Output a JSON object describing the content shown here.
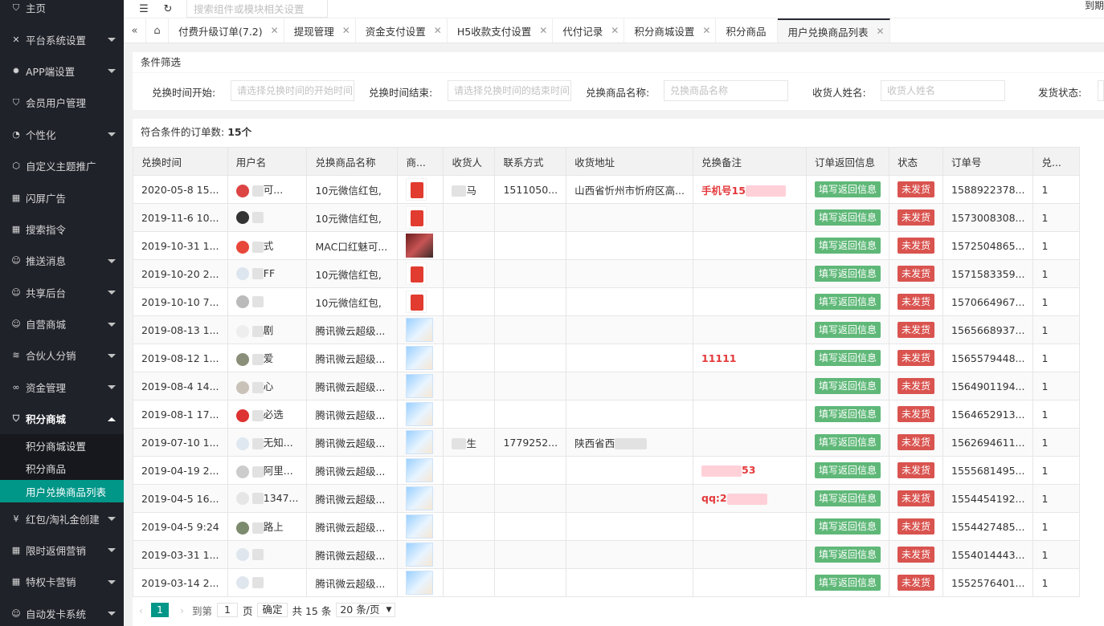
{
  "sidebar": {
    "items": [
      {
        "label": "主页",
        "icon": "shield-icon",
        "arrow": false
      },
      {
        "label": "平台系统设置",
        "icon": "tools-icon",
        "arrow": true
      },
      {
        "label": "APP端设置",
        "icon": "gear-icon",
        "arrow": true
      },
      {
        "label": "会员用户管理",
        "icon": "shield-icon",
        "arrow": false
      },
      {
        "label": "个性化",
        "icon": "palette-icon",
        "arrow": true
      },
      {
        "label": "自定义主题推广",
        "icon": "cube-icon",
        "arrow": false
      },
      {
        "label": "闪屏广告",
        "icon": "grid-icon",
        "arrow": false
      },
      {
        "label": "搜索指令",
        "icon": "grid-icon",
        "arrow": false
      },
      {
        "label": "推送消息",
        "icon": "user-icon",
        "arrow": true
      },
      {
        "label": "共享后台",
        "icon": "user-icon",
        "arrow": true
      },
      {
        "label": "自营商城",
        "icon": "user-icon",
        "arrow": true
      },
      {
        "label": "合伙人分销",
        "icon": "layers-icon",
        "arrow": true
      },
      {
        "label": "资金管理",
        "icon": "link-icon",
        "arrow": true
      },
      {
        "label": "积分商城",
        "icon": "shield-icon",
        "arrow": true,
        "open": true
      }
    ],
    "sub_items": [
      {
        "label": "积分商城设置",
        "active": false
      },
      {
        "label": "积分商品",
        "active": false
      },
      {
        "label": "用户兑换商品列表",
        "active": true
      }
    ],
    "items_after": [
      {
        "label": "红包/淘礼金创建",
        "icon": "currency-icon",
        "arrow": true
      },
      {
        "label": "限时返佣营销",
        "icon": "grid-icon",
        "arrow": true
      },
      {
        "label": "特权卡营销",
        "icon": "grid-icon",
        "arrow": true
      },
      {
        "label": "自动发卡系统",
        "icon": "user-icon",
        "arrow": true
      }
    ]
  },
  "topbar": {
    "search_placeholder": "搜索组件或模块相关设置",
    "right_text": "到期"
  },
  "tabs": [
    {
      "label": "付费升级订单(7.2)",
      "active": false
    },
    {
      "label": "提现管理",
      "active": false
    },
    {
      "label": "资金支付设置",
      "active": false
    },
    {
      "label": "H5收款支付设置",
      "active": false
    },
    {
      "label": "代付记录",
      "active": false
    },
    {
      "label": "积分商城设置",
      "active": false
    },
    {
      "label": "积分商品",
      "active": false,
      "no_close": true
    },
    {
      "label": "用户兑换商品列表",
      "active": true
    }
  ],
  "filter": {
    "title": "条件筛选",
    "fields": [
      {
        "label": "兑换时间开始:",
        "placeholder": "请选择兑换时间的开始时间"
      },
      {
        "label": "兑换时间结束:",
        "placeholder": "请选择兑换时间的结束时间"
      },
      {
        "label": "兑换商品名称:",
        "placeholder": "兑换商品名称"
      },
      {
        "label": "收货人姓名:",
        "placeholder": "收货人姓名"
      },
      {
        "label": "发货状态:",
        "placeholder": ""
      }
    ]
  },
  "summary": {
    "label": "符合条件的订单数:",
    "count": "15个"
  },
  "table": {
    "headers": [
      "兑换时间",
      "用户名",
      "兑换商品名称",
      "商...",
      "收货人",
      "联系方式",
      "收货地址",
      "兑换备注",
      "订单返回信息",
      "状态",
      "订单号",
      "兑..."
    ],
    "fill_button": "填写返回信息",
    "status_label": "未发货",
    "rows": [
      {
        "time": "2020-05-8 15...",
        "user": "可...",
        "avatar": "#d44",
        "goods": "10元微信红包,",
        "thumb": "red",
        "receiver": "马",
        "phone": "1511050...",
        "address": "山西省忻州市忻府区高...",
        "remark": "手机号15",
        "order": "1588922378...",
        "qty": "1"
      },
      {
        "time": "2019-11-6 10...",
        "user": "",
        "avatar": "#333",
        "goods": "10元微信红包,",
        "thumb": "red",
        "receiver": "",
        "phone": "",
        "address": "",
        "remark": "",
        "order": "1573008308...",
        "qty": "1"
      },
      {
        "time": "2019-10-31 1...",
        "user": "式",
        "avatar": "#e8483a",
        "goods": "MAC口红魅可...",
        "thumb": "mac",
        "receiver": "",
        "phone": "",
        "address": "",
        "remark": "",
        "order": "1572504865...",
        "qty": "1"
      },
      {
        "time": "2019-10-20 2...",
        "user": "FF",
        "avatar": "#dde6ef",
        "goods": "10元微信红包,",
        "thumb": "red",
        "receiver": "",
        "phone": "",
        "address": "",
        "remark": "",
        "order": "1571583359...",
        "qty": "1"
      },
      {
        "time": "2019-10-10 7...",
        "user": "",
        "avatar": "#bbb",
        "goods": "10元微信红包,",
        "thumb": "red",
        "receiver": "",
        "phone": "",
        "address": "",
        "remark": "",
        "order": "1570664967...",
        "qty": "1"
      },
      {
        "time": "2019-08-13 1...",
        "user": "剧",
        "avatar": "#eee",
        "goods": "腾讯微云超级...",
        "thumb": "cloud",
        "receiver": "",
        "phone": "",
        "address": "",
        "remark": "",
        "order": "1565668937...",
        "qty": "1"
      },
      {
        "time": "2019-08-12 1...",
        "user": "爱",
        "avatar": "#8a8f7a",
        "goods": "腾讯微云超级...",
        "thumb": "cloud",
        "receiver": "",
        "phone": "",
        "address": "",
        "remark": "11111",
        "order": "1565579448...",
        "qty": "1"
      },
      {
        "time": "2019-08-4 14...",
        "user": "心",
        "avatar": "#c9c2b8",
        "goods": "腾讯微云超级...",
        "thumb": "cloud",
        "receiver": "",
        "phone": "",
        "address": "",
        "remark": "",
        "order": "1564901194...",
        "qty": "1"
      },
      {
        "time": "2019-08-1 17...",
        "user": "必选",
        "avatar": "#d33",
        "goods": "腾讯微云超级...",
        "thumb": "cloud",
        "receiver": "",
        "phone": "",
        "address": "",
        "remark": "",
        "order": "1564652913...",
        "qty": "1"
      },
      {
        "time": "2019-07-10 1...",
        "user": "无知...",
        "avatar": "#dfe8f0",
        "goods": "腾讯微云超级...",
        "thumb": "cloud",
        "receiver": "生",
        "phone": "1779252...",
        "address": "陕西省西",
        "remark": "",
        "order": "1562694611...",
        "qty": "1"
      },
      {
        "time": "2019-04-19 2...",
        "user": "阿里...",
        "avatar": "#ccc",
        "goods": "腾讯微云超级...",
        "thumb": "cloud",
        "receiver": "",
        "phone": "",
        "address": "",
        "remark": "53",
        "order": "1555681495...",
        "qty": "1"
      },
      {
        "time": "2019-04-5 16...",
        "user": "1347...",
        "avatar": "#e6e6e6",
        "goods": "腾讯微云超级...",
        "thumb": "cloud",
        "receiver": "",
        "phone": "",
        "address": "",
        "remark": "qq:2",
        "order": "1554454192...",
        "qty": "1"
      },
      {
        "time": "2019-04-5 9:24",
        "user": "路上",
        "avatar": "#7c8a6e",
        "goods": "腾讯微云超级...",
        "thumb": "cloud",
        "receiver": "",
        "phone": "",
        "address": "",
        "remark": "",
        "order": "1554427485...",
        "qty": "1"
      },
      {
        "time": "2019-03-31 1...",
        "user": "",
        "avatar": "#dfe6ee",
        "goods": "腾讯微云超级...",
        "thumb": "cloud",
        "receiver": "",
        "phone": "",
        "address": "",
        "remark": "",
        "order": "1554014443...",
        "qty": "1"
      },
      {
        "time": "2019-03-14 2...",
        "user": "",
        "avatar": "#dfe6ee",
        "goods": "腾讯微云超级...",
        "thumb": "cloud",
        "receiver": "",
        "phone": "",
        "address": "",
        "remark": "",
        "order": "1552576401...",
        "qty": "1"
      }
    ]
  },
  "pager": {
    "prev": "‹",
    "current": "1",
    "next": "›",
    "goto_label": "到第",
    "goto_value": "1",
    "page_unit": "页",
    "confirm": "确定",
    "total": "共 15 条",
    "page_size": "20 条/页"
  },
  "colors": {
    "sidebar_bg": "#20222a",
    "accent": "#009688",
    "green_btn": "#5fb878",
    "red_btn": "#d9534f",
    "remark_red": "#e4393c"
  }
}
